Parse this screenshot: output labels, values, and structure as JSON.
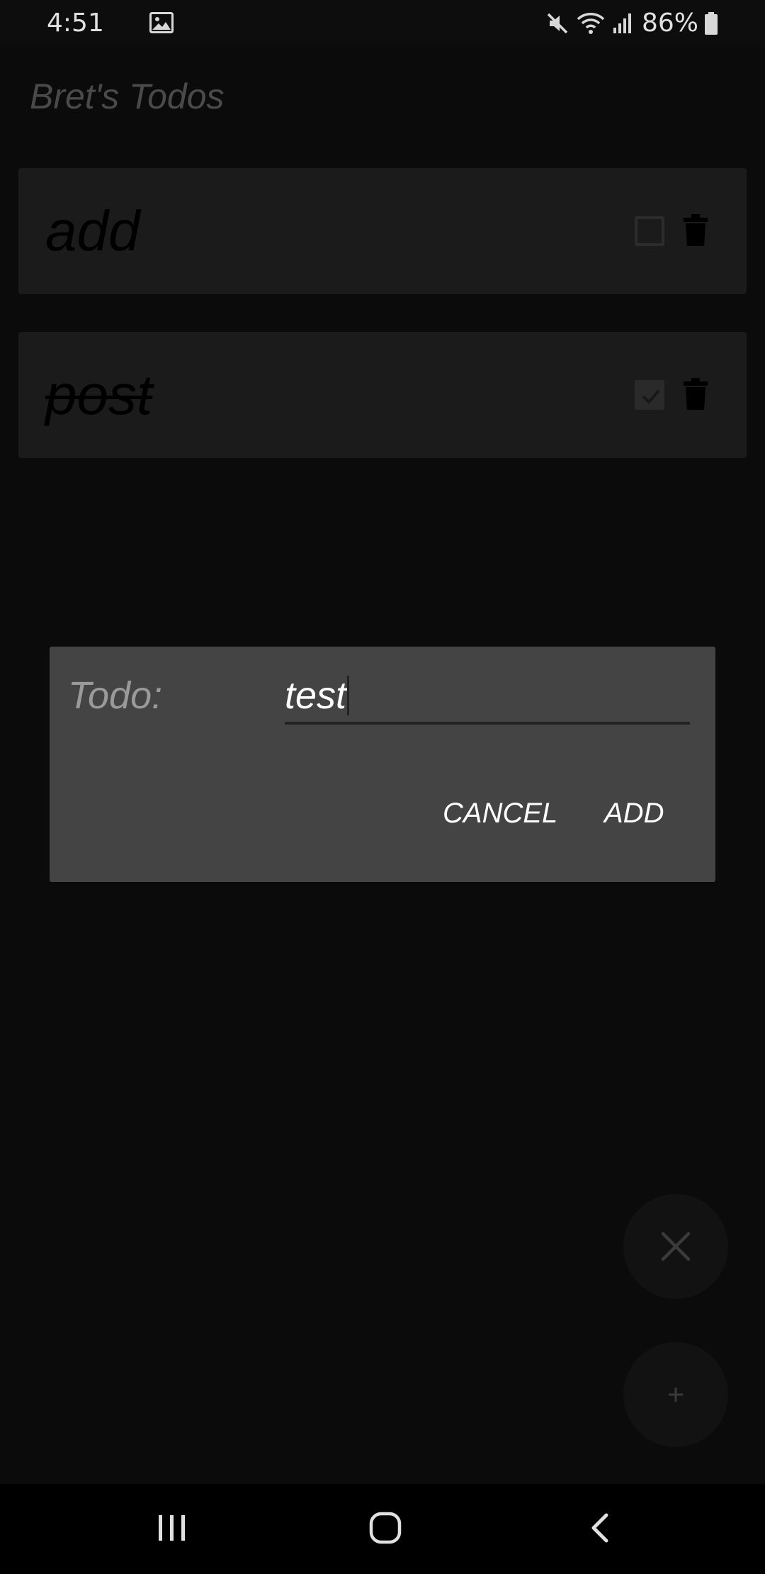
{
  "status_bar": {
    "time": "4:51",
    "battery": "86%",
    "icons": [
      "gallery-icon",
      "mute-icon",
      "wifi-icon",
      "signal-icon",
      "battery-icon"
    ]
  },
  "app": {
    "title": "Bret's Todos"
  },
  "todos": [
    {
      "text": "add",
      "completed": false
    },
    {
      "text": "post",
      "completed": true
    }
  ],
  "dialog": {
    "label": "Todo:",
    "input_value": "test",
    "cancel_label": "CANCEL",
    "add_label": "ADD"
  },
  "fabs": {
    "close_icon": "close-icon",
    "add_icon": "plus-icon"
  },
  "nav_bar": {
    "icons": [
      "recents-icon",
      "home-icon",
      "back-icon"
    ]
  },
  "colors": {
    "background": "#0b0b0b",
    "card": "#1b1b1b",
    "dialog": "#444444",
    "dialog_text": "#ffffff"
  }
}
